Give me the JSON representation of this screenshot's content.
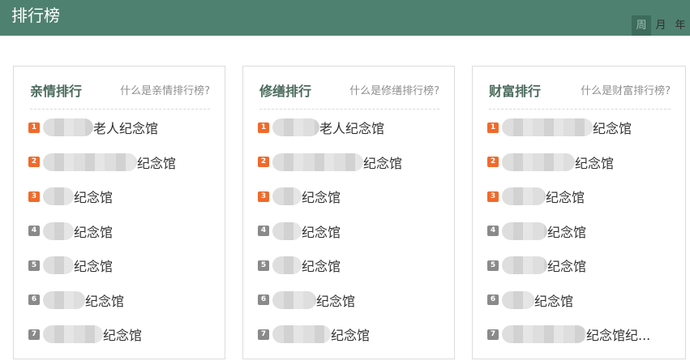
{
  "header": {
    "title": "排行榜",
    "tabs": [
      {
        "label": "周",
        "active": true
      },
      {
        "label": "月",
        "active": false
      },
      {
        "label": "年",
        "active": false
      }
    ]
  },
  "panels": [
    {
      "title": "亲情排行",
      "help": "什么是亲情排行榜?",
      "items": [
        {
          "rank": "1",
          "suffix": "老人纪念馆"
        },
        {
          "rank": "2",
          "suffix": "纪念馆"
        },
        {
          "rank": "3",
          "suffix": "纪念馆"
        },
        {
          "rank": "4",
          "suffix": "纪念馆"
        },
        {
          "rank": "5",
          "suffix": "纪念馆"
        },
        {
          "rank": "6",
          "suffix": "纪念馆"
        },
        {
          "rank": "7",
          "suffix": "纪念馆"
        }
      ]
    },
    {
      "title": "修缮排行",
      "help": "什么是修缮排行榜?",
      "items": [
        {
          "rank": "1",
          "suffix": "老人纪念馆"
        },
        {
          "rank": "2",
          "suffix": "纪念馆"
        },
        {
          "rank": "3",
          "suffix": "纪念馆"
        },
        {
          "rank": "4",
          "suffix": "纪念馆"
        },
        {
          "rank": "5",
          "suffix": "纪念馆"
        },
        {
          "rank": "6",
          "suffix": "纪念馆"
        },
        {
          "rank": "7",
          "suffix": "纪念馆"
        }
      ]
    },
    {
      "title": "财富排行",
      "help": "什么是财富排行榜?",
      "items": [
        {
          "rank": "1",
          "suffix": "纪念馆"
        },
        {
          "rank": "2",
          "suffix": "纪念馆"
        },
        {
          "rank": "3",
          "suffix": "纪念馆"
        },
        {
          "rank": "4",
          "suffix": "纪念馆"
        },
        {
          "rank": "5",
          "suffix": "纪念馆"
        },
        {
          "rank": "6",
          "suffix": "纪念馆"
        },
        {
          "rank": "7",
          "suffix": "纪念馆纪..."
        }
      ]
    }
  ],
  "colors": {
    "header_bg": "#4f8170",
    "top_rank": "#f06a2b",
    "other_rank": "#8a8a8a"
  }
}
